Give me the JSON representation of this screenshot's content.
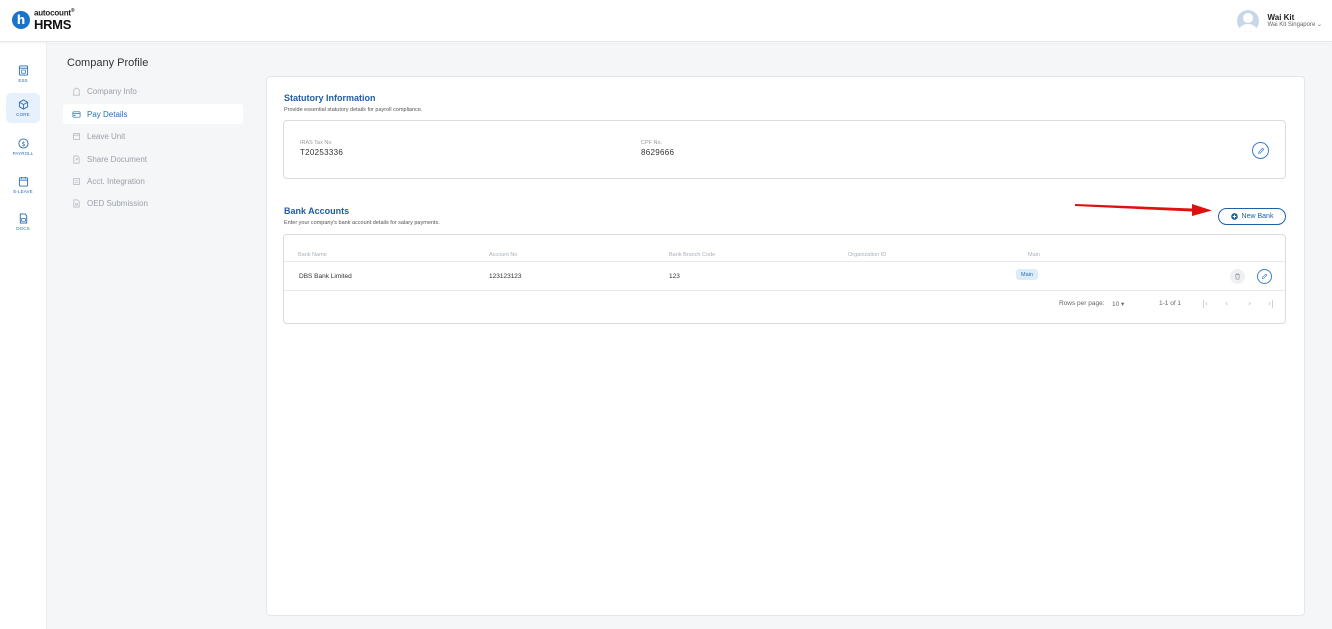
{
  "brand": {
    "small": "autocount",
    "big": "HRMS"
  },
  "user": {
    "name": "Wai Kit",
    "company": "Wai Kit Singapore"
  },
  "rail": [
    {
      "label": "ESS",
      "icon": "ess-icon"
    },
    {
      "label": "CORE",
      "icon": "core-icon"
    },
    {
      "label": "PAYROLL",
      "icon": "payroll-icon"
    },
    {
      "label": "E-LEAVE",
      "icon": "eleave-icon"
    },
    {
      "label": "DOCS",
      "icon": "docs-icon"
    }
  ],
  "subnav": {
    "title": "Company Profile",
    "items": [
      {
        "label": "Company Info"
      },
      {
        "label": "Pay Details"
      },
      {
        "label": "Leave Unit"
      },
      {
        "label": "Share Document"
      },
      {
        "label": "Acct. Integration"
      },
      {
        "label": "OED Submission"
      }
    ]
  },
  "statutory": {
    "title": "Statutory Information",
    "description": "Provide essential statutory details for payroll compliance.",
    "iras_label": "IRAS Tax No",
    "iras_value": "T20253336",
    "cpf_label": "CPF No.",
    "cpf_value": "8629666"
  },
  "bank": {
    "title": "Bank Accounts",
    "description": "Enter your company's bank account details for salary payments.",
    "new_button": "New Bank",
    "columns": [
      "Bank Name",
      "Account No",
      "Bank Branch Code",
      "Organization ID",
      "Main"
    ],
    "rows": [
      {
        "bank_name": "DBS Bank Limited",
        "account_no": "123123123",
        "branch_code": "123",
        "org_id": "",
        "main": "Main"
      }
    ],
    "pager": {
      "rows_label": "Rows per page:",
      "rows_value": "10",
      "range": "1-1 of 1"
    }
  },
  "colors": {
    "accent": "#1f5fa3",
    "annotation_arrow": "#e01010"
  }
}
